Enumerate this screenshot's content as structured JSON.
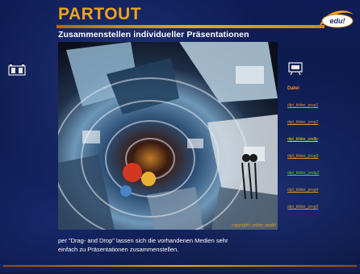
{
  "header": {
    "title": "PARTOUT",
    "subtitle": "Zusammenstellen individueller Präsentationen",
    "logo_text": "edu!"
  },
  "image": {
    "copyright": "copyright: urban zeidel"
  },
  "right_panel": {
    "icon": "presentation-icon",
    "items": [
      {
        "label": "Datei",
        "state": "active"
      },
      {
        "label": "dipl_bilder_prog1",
        "state": "normal"
      },
      {
        "label": "dipl_bilder_prog2",
        "state": "normal"
      },
      {
        "label": "dipl_bilder_endlp",
        "state": "yellow"
      },
      {
        "label": "dipl_bilder_prog3",
        "state": "normal"
      },
      {
        "label": "dipl_bilder_endg2",
        "state": "green"
      },
      {
        "label": "dipl_bilder_prog4",
        "state": "normal"
      },
      {
        "label": "dipl_bilder_prog5",
        "state": "normal"
      }
    ]
  },
  "left_panel": {
    "icon": "film-icon"
  },
  "caption": {
    "line1": "per \"Drag- and Drop\" lassen sich die vorhandenen Medien sehr",
    "line2": "einfach zu Präsentationen zusammenstellen."
  },
  "colors": {
    "accent": "#f0a318",
    "background": "#0b1a4a",
    "text": "#ffffff"
  }
}
